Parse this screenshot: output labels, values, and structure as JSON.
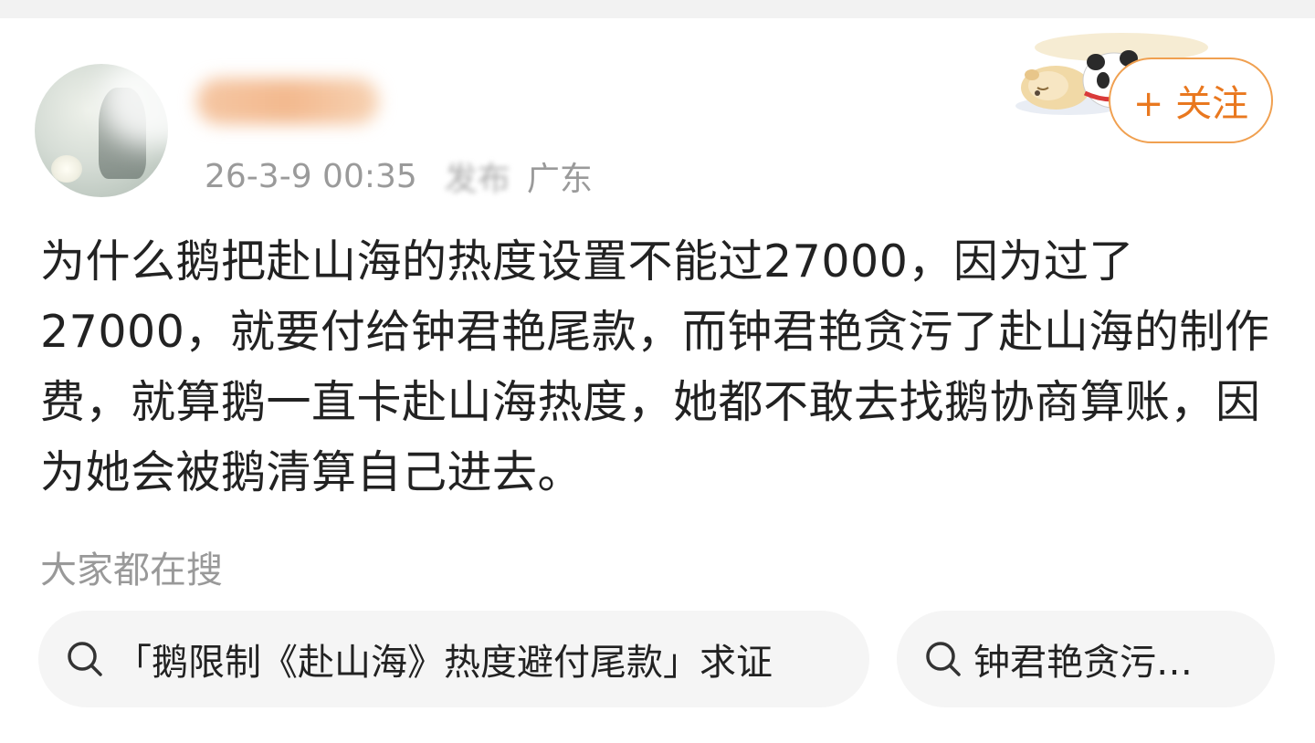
{
  "post": {
    "time": "26-3-9 00:35",
    "source_partial": "发布",
    "location": "广东",
    "follow_label": "+ 关注",
    "text": "为什么鹅把赴山海的热度设置不能过27000，因为过了27000，就要付给钟君艳尾款，而钟君艳贪污了赴山海的制作费，就算鹅一直卡赴山海热度，她都不敢去找鹅协商算账，因为她会被鹅清算自己进去。"
  },
  "search": {
    "title": "大家都在搜",
    "chips": [
      {
        "label": "「鹅限制《赴山海》热度避付尾款」求证"
      },
      {
        "label": "钟君艳贪污…"
      }
    ]
  },
  "colors": {
    "accent": "#e9781f",
    "follow_border": "#f0a050",
    "text_primary": "#222222",
    "text_secondary": "#999999",
    "chip_bg": "#f5f5f5"
  },
  "icons": [
    "search-icon",
    "decorative-animals-icon"
  ]
}
